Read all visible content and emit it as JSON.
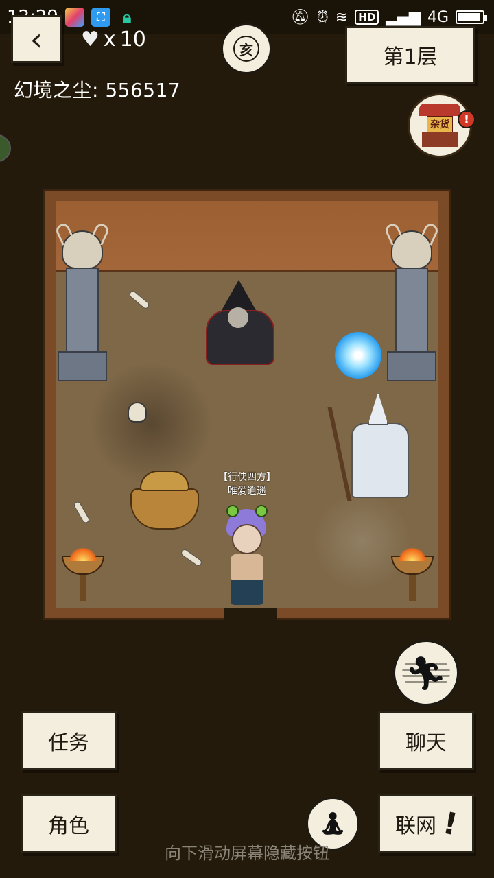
{
  "status_bar": {
    "time": "12:29",
    "network_label": "4G",
    "hd_label": "HD",
    "battery_fill": 0.85
  },
  "top_bar": {
    "back_icon": "back-arrow-icon",
    "hearts_prefix": "x",
    "hearts_count": "10",
    "heart_icon": "heart-icon",
    "dust_label": "幻境之尘:",
    "dust_value": "556517",
    "zodiac_char": "亥",
    "floor_label": "第1层"
  },
  "shop": {
    "sign": "杂货",
    "icon": "shop-icon",
    "alert": "!"
  },
  "room": {
    "player_title": "【行侠四方】",
    "player_name": "唯爱逍遥",
    "colors": {
      "wall": "#a3673a",
      "floor": "#7e6848",
      "border": "#3b2410"
    }
  },
  "actions": {
    "run_icon": "run-icon",
    "meditate_icon": "meditate-icon",
    "task_label": "任务",
    "role_label": "角色",
    "chat_label": "聊天",
    "network_label": "联网",
    "network_alert": "!"
  },
  "hint": "向下滑动屏幕隐藏按钮",
  "theme": {
    "background": "#231a0b",
    "paper": "#f4eedf",
    "ink": "#1e1a12"
  }
}
